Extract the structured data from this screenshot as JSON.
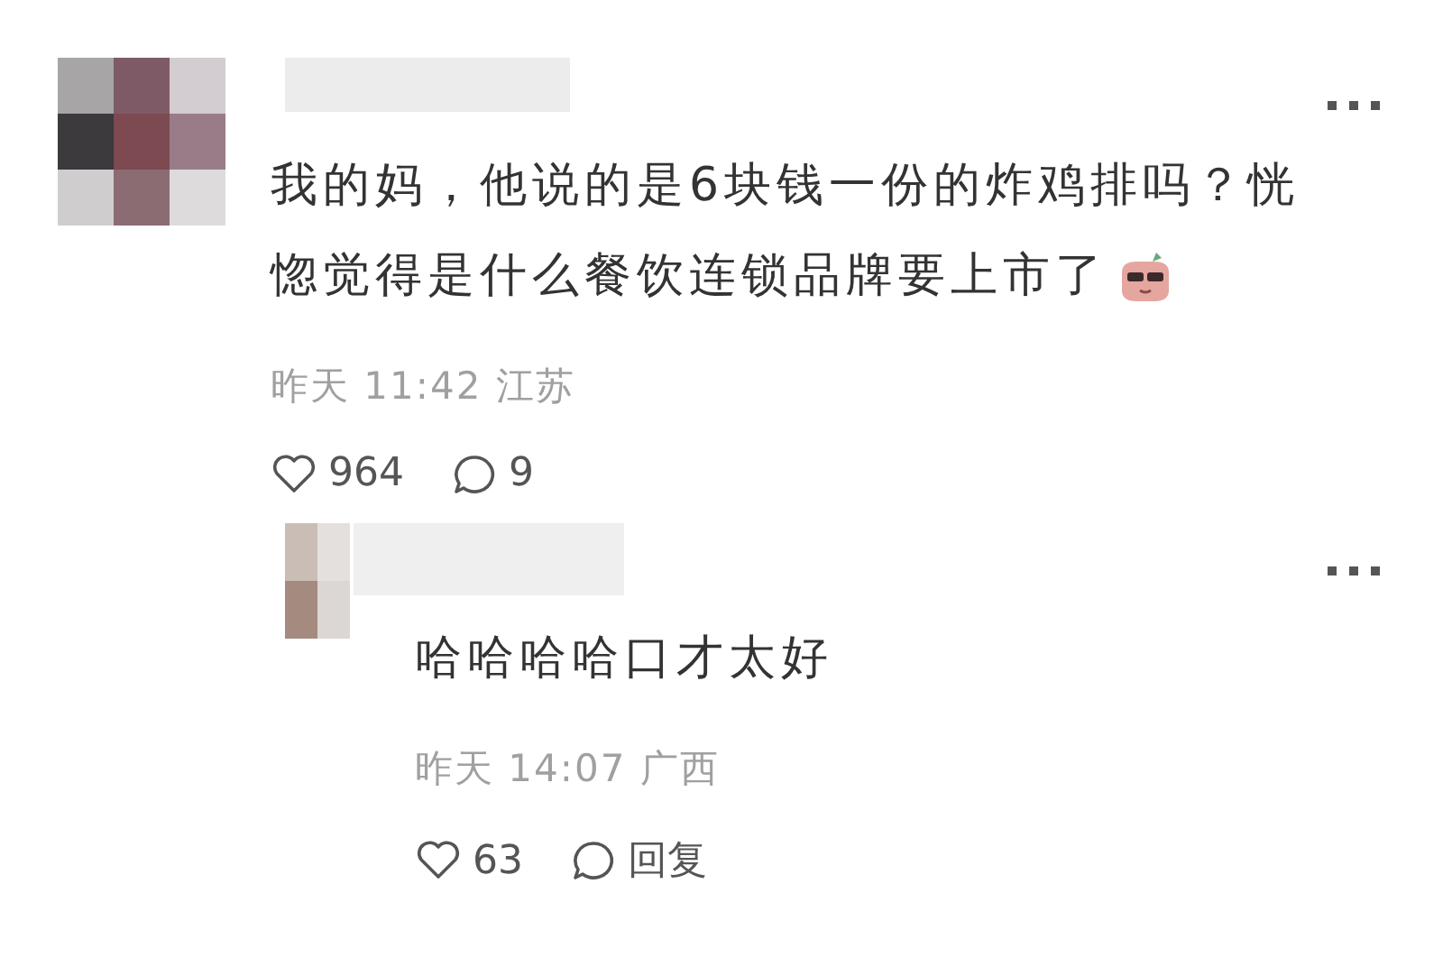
{
  "comments": [
    {
      "text": "我的妈，他说的是6块钱一份的炸鸡排吗？恍惚觉得是什么餐饮连锁品牌要上市了",
      "emoji": true,
      "meta": "昨天 11:42 江苏",
      "likes": "964",
      "comment_count": "9",
      "children": [
        {
          "text": "哈哈哈哈口才太好",
          "emoji": false,
          "meta": "昨天 14:07 广西",
          "likes": "63",
          "reply_label": "回复"
        }
      ]
    }
  ]
}
